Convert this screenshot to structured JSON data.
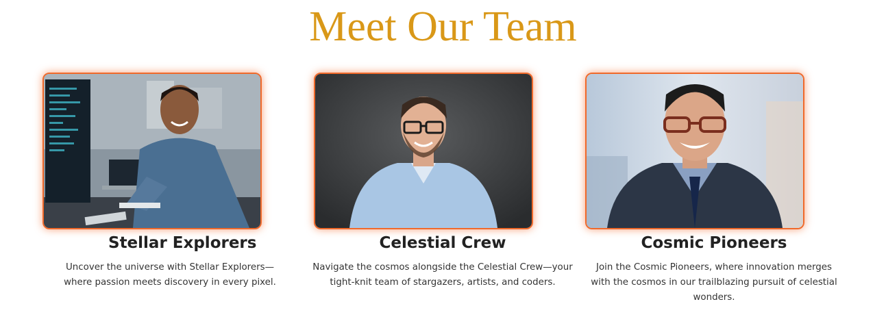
{
  "page": {
    "title": "Meet Our Team",
    "accent_color": "#d99818",
    "card_border_color": "#f0692a"
  },
  "team": [
    {
      "name": "Stellar Explorers",
      "description": "Uncover the universe with Stellar Explorers—where passion meets discovery in every pixel.",
      "photo": "developer-at-computer-photo"
    },
    {
      "name": "Celestial Crew",
      "description": "Navigate the cosmos alongside the Celestial Crew—your tight-knit team of stargazers, artists, and coders.",
      "photo": "man-with-glasses-portrait-photo"
    },
    {
      "name": "Cosmic Pioneers",
      "description": "Join the Cosmic Pioneers, where innovation merges with the cosmos in our trailblazing pursuit of celestial wonders.",
      "photo": "businessman-in-suit-portrait-photo"
    }
  ]
}
